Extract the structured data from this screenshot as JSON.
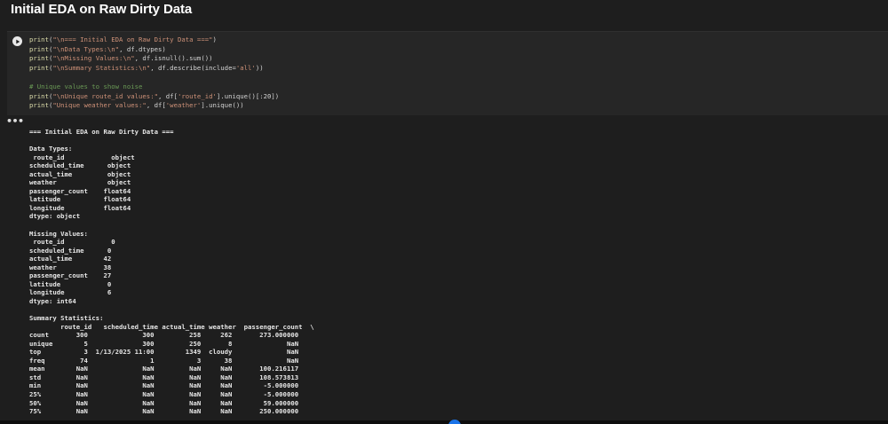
{
  "notebook": {
    "heading": "Initial EDA on Raw Dirty Data"
  },
  "code_cell": {
    "run_icon": "play-icon",
    "lines": [
      [
        [
          "fn",
          "print"
        ],
        [
          "p",
          "("
        ],
        [
          "s",
          "\"\\n=== Initial EDA on Raw Dirty Data ===\""
        ],
        [
          "p",
          ")"
        ]
      ],
      [
        [
          "fn",
          "print"
        ],
        [
          "p",
          "("
        ],
        [
          "s",
          "\"\\nData Types:\\n\""
        ],
        [
          "p",
          ", df.dtypes)"
        ]
      ],
      [
        [
          "fn",
          "print"
        ],
        [
          "p",
          "("
        ],
        [
          "s",
          "\"\\nMissing Values:\\n\""
        ],
        [
          "p",
          ", df.isnull().sum())"
        ]
      ],
      [
        [
          "fn",
          "print"
        ],
        [
          "p",
          "("
        ],
        [
          "s",
          "\"\\nSummary Statistics:\\n\""
        ],
        [
          "p",
          ", df.describe(include="
        ],
        [
          "s",
          "'all'"
        ],
        [
          "p",
          "))"
        ]
      ],
      [],
      [
        [
          "c",
          "# Unique values to show noise"
        ]
      ],
      [
        [
          "fn",
          "print"
        ],
        [
          "p",
          "("
        ],
        [
          "s",
          "\"\\nUnique route_id values:\""
        ],
        [
          "p",
          ", df["
        ],
        [
          "s",
          "'route_id'"
        ],
        [
          "p",
          "].unique()[:20])"
        ]
      ],
      [
        [
          "fn",
          "print"
        ],
        [
          "p",
          "("
        ],
        [
          "s",
          "\"Unique weather values:\""
        ],
        [
          "p",
          ", df["
        ],
        [
          "s",
          "'weather'"
        ],
        [
          "p",
          "].unique())"
        ]
      ]
    ]
  },
  "output_cell": {
    "toggle_label": "•••",
    "lines": [
      "=== Initial EDA on Raw Dirty Data ===",
      "",
      "Data Types:",
      " route_id            object",
      "scheduled_time      object",
      "actual_time         object",
      "weather             object",
      "passenger_count    float64",
      "latitude           float64",
      "longitude          float64",
      "dtype: object",
      "",
      "Missing Values:",
      " route_id            0",
      "scheduled_time      0",
      "actual_time        42",
      "weather            38",
      "passenger_count    27",
      "latitude            0",
      "longitude           6",
      "dtype: int64",
      "",
      "Summary Statistics:",
      "        route_id   scheduled_time actual_time weather  passenger_count  \\",
      "count       300              300         258     262       273.000000",
      "unique        5              300         250       8              NaN",
      "top           3  1/13/2025 11:00        1349  cloudy              NaN",
      "freq         74                1           3      38              NaN",
      "mean        NaN              NaN         NaN     NaN       100.216117",
      "std         NaN              NaN         NaN     NaN       108.573813",
      "min         NaN              NaN         NaN     NaN        -5.000000",
      "25%         NaN              NaN         NaN     NaN        -5.000000",
      "50%         NaN              NaN         NaN     NaN        59.000000",
      "75%         NaN              NaN         NaN     NaN       250.000000"
    ]
  }
}
